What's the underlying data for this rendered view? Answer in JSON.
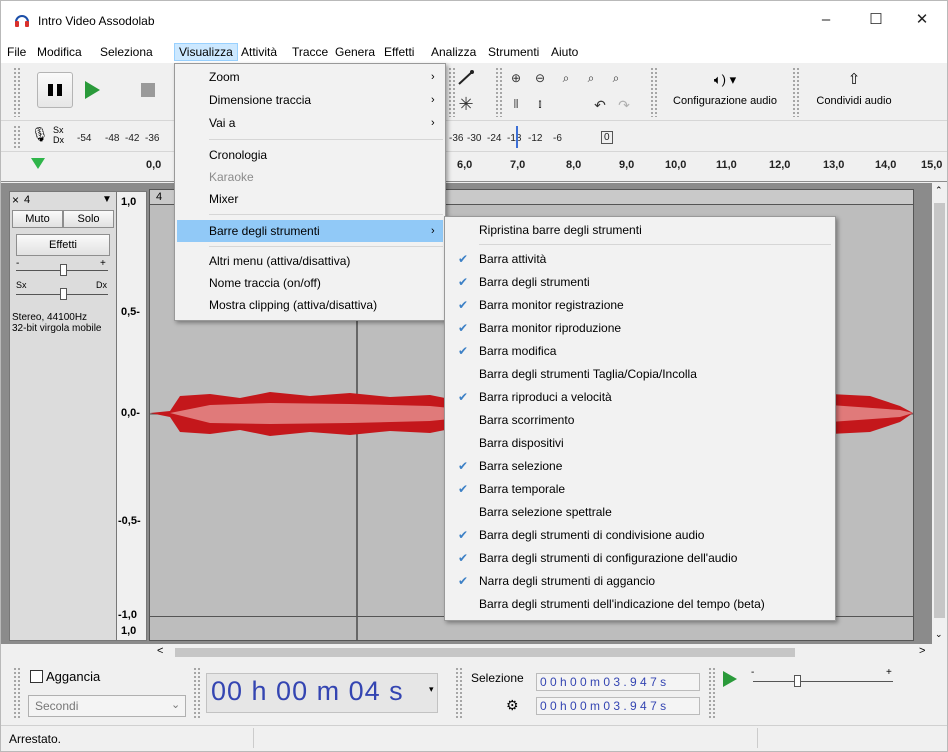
{
  "window": {
    "title": "Intro Video Assodolab",
    "minimize": "–",
    "maximize": "☐",
    "close": "✕"
  },
  "menubar": {
    "items": [
      "File",
      "Modifica",
      "Seleziona",
      "Visualizza",
      "Attività",
      "Tracce",
      "Genera",
      "Effetti",
      "Analizza",
      "Strumenti",
      "Aiuto"
    ],
    "active": "Visualizza"
  },
  "toolbar": {
    "audio_setup": "Configurazione audio",
    "audio_setup_arrow": "▾",
    "share_audio": "Condividi audio"
  },
  "meter": {
    "labels": [
      "Sx",
      "Dx"
    ],
    "ticks_left": [
      "-54",
      "-48",
      "-42",
      "-36"
    ],
    "ticks_right": [
      "-36",
      "-30",
      "-24",
      "-18",
      "-12",
      "-6",
      "0"
    ]
  },
  "ruler": {
    "ticks": [
      "0,0",
      "6,0",
      "7,0",
      "8,0",
      "9,0",
      "10,0",
      "11,0",
      "12,0",
      "13,0",
      "14,0",
      "15,0"
    ]
  },
  "track": {
    "close": "×",
    "name": "4",
    "menu_arrow": "▼",
    "mute": "Muto",
    "solo": "Solo",
    "effects": "Effetti",
    "gain_minus": "-",
    "gain_plus": "+",
    "pan_left": "Sx",
    "pan_right": "Dx",
    "info_line1": "Stereo, 44100Hz",
    "info_line2": "32-bit virgola mobile",
    "clip_name": "4",
    "scale": [
      "1,0",
      "0,5-",
      "0,0-",
      "-0,5-",
      "-1,0",
      "1,0"
    ]
  },
  "view_menu": {
    "items": [
      {
        "label": "Zoom",
        "submenu": true,
        "disabled": false
      },
      {
        "label": "Dimensione traccia",
        "submenu": true,
        "disabled": false
      },
      {
        "label": "Vai a",
        "submenu": true,
        "disabled": false
      },
      {
        "label": "Cronologia",
        "submenu": false,
        "disabled": false
      },
      {
        "label": "Karaoke",
        "submenu": false,
        "disabled": true
      },
      {
        "label": "Mixer",
        "submenu": false,
        "disabled": false
      },
      {
        "label": "Barre degli strumenti",
        "submenu": true,
        "disabled": false,
        "highlighted": true
      },
      {
        "label": "Altri menu (attiva/disattiva)",
        "submenu": false,
        "disabled": false
      },
      {
        "label": "Nome traccia (on/off)",
        "submenu": false,
        "disabled": false
      },
      {
        "label": "Mostra clipping (attiva/disattiva)",
        "submenu": false,
        "disabled": false
      }
    ]
  },
  "toolbars_submenu": {
    "reset": "Ripristina barre degli strumenti",
    "items": [
      {
        "label": "Barra attività",
        "checked": true
      },
      {
        "label": "Barra degli strumenti",
        "checked": true
      },
      {
        "label": "Barra monitor registrazione",
        "checked": true
      },
      {
        "label": "Barra monitor riproduzione",
        "checked": true
      },
      {
        "label": "Barra modifica",
        "checked": true
      },
      {
        "label": "Barra degli strumenti Taglia/Copia/Incolla",
        "checked": false
      },
      {
        "label": "Barra riproduci a velocità",
        "checked": true
      },
      {
        "label": "Barra scorrimento",
        "checked": false
      },
      {
        "label": "Barra dispositivi",
        "checked": false
      },
      {
        "label": "Barra selezione",
        "checked": true
      },
      {
        "label": "Barra temporale",
        "checked": true
      },
      {
        "label": "Barra selezione spettrale",
        "checked": false
      },
      {
        "label": "Barra degli strumenti di condivisione audio",
        "checked": true
      },
      {
        "label": "Barra degli strumenti di configurazione dell'audio",
        "checked": true
      },
      {
        "label": "Narra degli strumenti di aggancio",
        "checked": true
      },
      {
        "label": "Barra degli strumenti dell'indicazione del tempo (beta)",
        "checked": false
      }
    ]
  },
  "bottom": {
    "snap_label": "Aggancia",
    "snap_unit": "Secondi",
    "time_display": "00 h 00 m 04 s",
    "selection_label": "Selezione",
    "sel_start": "0 0 h 0 0 m 0 3 . 9 4 7 s",
    "sel_end": "0 0 h 0 0 m 0 3 . 9 4 7 s",
    "speed_minus": "-",
    "speed_plus": "+"
  },
  "status": {
    "text": "Arrestato."
  },
  "colors": {
    "accent": "#3c80c6",
    "highlight": "#91c9f7",
    "waveform": "#c4171b",
    "play": "#2a9a3a"
  }
}
